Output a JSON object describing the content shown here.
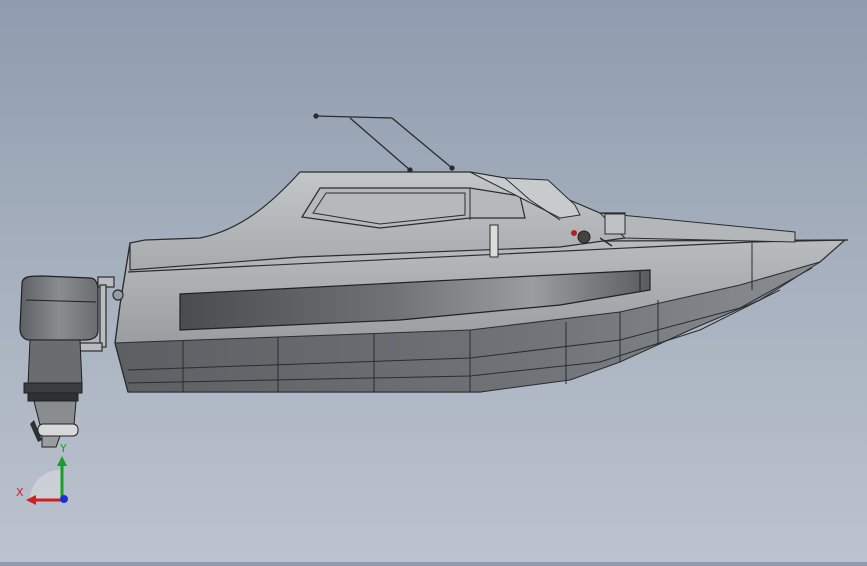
{
  "viewport": {
    "background_top": "#8f9caf",
    "background_bottom": "#bcc3cf"
  },
  "model": {
    "parts": [
      "hull",
      "cabin",
      "windshield",
      "roof-rails",
      "outboard-motor",
      "side-window-band"
    ]
  },
  "triad": {
    "x_label": "X",
    "y_label": "Y",
    "x_color": "#d21e1e",
    "y_color": "#1a9e2a",
    "z_color": "#1c2fd6"
  }
}
